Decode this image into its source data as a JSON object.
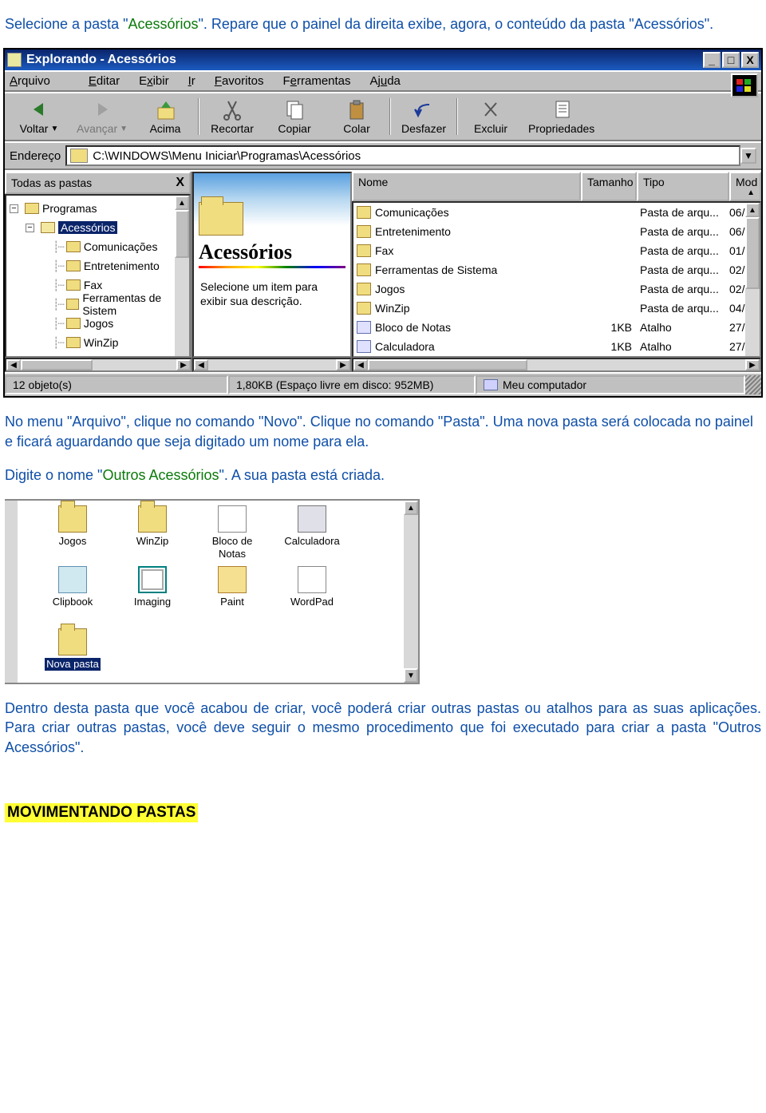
{
  "intro": {
    "p1a": "Selecione a pasta \"",
    "p1_green": "Acessórios",
    "p1b": "\". Repare que o painel da direita exibe, agora, o conteúdo da pasta \"Acessórios\"."
  },
  "window": {
    "title": "Explorando - Acessórios",
    "sys": {
      "min": "_",
      "max": "□",
      "close": "X"
    },
    "menus": [
      "Arquivo",
      "Editar",
      "Exibir",
      "Ir",
      "Favoritos",
      "Ferramentas",
      "Ajuda"
    ],
    "toolbar": [
      {
        "label": "Voltar",
        "dropdown": true
      },
      {
        "label": "Avançar",
        "dropdown": true,
        "disabled": true
      },
      {
        "label": "Acima"
      },
      {
        "label": "Recortar"
      },
      {
        "label": "Copiar"
      },
      {
        "label": "Colar"
      },
      {
        "label": "Desfazer"
      },
      {
        "label": "Excluir"
      },
      {
        "label": "Propriedades"
      }
    ],
    "address": {
      "label": "Endereço",
      "path": "C:\\WINDOWS\\Menu Iniciar\\Programas\\Acessórios"
    },
    "tree": {
      "header": "Todas as pastas",
      "close": "X",
      "items": [
        {
          "indent": 0,
          "exp": "-",
          "label": "Programas"
        },
        {
          "indent": 1,
          "exp": "-",
          "label": "Acessórios",
          "selected": true,
          "open": true
        },
        {
          "indent": 2,
          "label": "Comunicações"
        },
        {
          "indent": 2,
          "label": "Entretenimento"
        },
        {
          "indent": 2,
          "label": "Fax"
        },
        {
          "indent": 2,
          "label": "Ferramentas de Sistem"
        },
        {
          "indent": 2,
          "label": "Jogos"
        },
        {
          "indent": 2,
          "label": "WinZip"
        }
      ]
    },
    "mid": {
      "title": "Acessórios",
      "desc": "Selecione um item para exibir sua descrição."
    },
    "list": {
      "headers": {
        "name": "Nome",
        "size": "Tamanho",
        "type": "Tipo",
        "mod": "Mod"
      },
      "rows": [
        {
          "icon": "folder",
          "name": "Comunicações",
          "size": "",
          "type": "Pasta de arqu...",
          "mod": "06/"
        },
        {
          "icon": "folder",
          "name": "Entretenimento",
          "size": "",
          "type": "Pasta de arqu...",
          "mod": "06/"
        },
        {
          "icon": "folder",
          "name": "Fax",
          "size": "",
          "type": "Pasta de arqu...",
          "mod": "01/"
        },
        {
          "icon": "folder",
          "name": "Ferramentas de Sistema",
          "size": "",
          "type": "Pasta de arqu...",
          "mod": "02/"
        },
        {
          "icon": "folder",
          "name": "Jogos",
          "size": "",
          "type": "Pasta de arqu...",
          "mod": "02/"
        },
        {
          "icon": "folder",
          "name": "WinZip",
          "size": "",
          "type": "Pasta de arqu...",
          "mod": "04/"
        },
        {
          "icon": "short",
          "name": "Bloco de Notas",
          "size": "1KB",
          "type": "Atalho",
          "mod": "27/"
        },
        {
          "icon": "short",
          "name": "Calculadora",
          "size": "1KB",
          "type": "Atalho",
          "mod": "27/"
        }
      ]
    },
    "status": {
      "objects": "12 objeto(s)",
      "space": "1,80KB (Espaço livre em disco: 952MB)",
      "location": "Meu computador"
    }
  },
  "mid_text": {
    "p2": "No menu \"Arquivo\", clique no comando \"Novo\". Clique no comando \"Pasta\". Uma nova pasta será colocada no painel e ficará aguardando que seja digitado um nome para ela.",
    "p3a": "Digite o nome \"",
    "p3_green": "Outros Acessórios",
    "p3b": "\". A sua pasta está criada."
  },
  "iconview": {
    "row1": [
      {
        "label": "Jogos",
        "icon": "folder"
      },
      {
        "label": "WinZip",
        "icon": "folder"
      },
      {
        "label": "Bloco de Notas",
        "icon": "short"
      },
      {
        "label": "Calculadora",
        "icon": "calc"
      }
    ],
    "row2": [
      {
        "label": "Clipbook",
        "icon": "clip"
      },
      {
        "label": "Imaging",
        "icon": "img"
      },
      {
        "label": "Paint",
        "icon": "paint"
      },
      {
        "label": "WordPad",
        "icon": "wordpad"
      }
    ],
    "row3": [
      {
        "label": "Nova pasta",
        "icon": "newfolder",
        "selected": true
      }
    ]
  },
  "outro": "Dentro desta pasta que você acabou de criar, você poderá criar outras pastas ou atalhos para as suas aplicações. Para criar outras pastas, você deve seguir o mesmo procedimento que foi executado para criar a pasta \"Outros Acessórios\".",
  "section": "MOVIMENTANDO PASTAS"
}
